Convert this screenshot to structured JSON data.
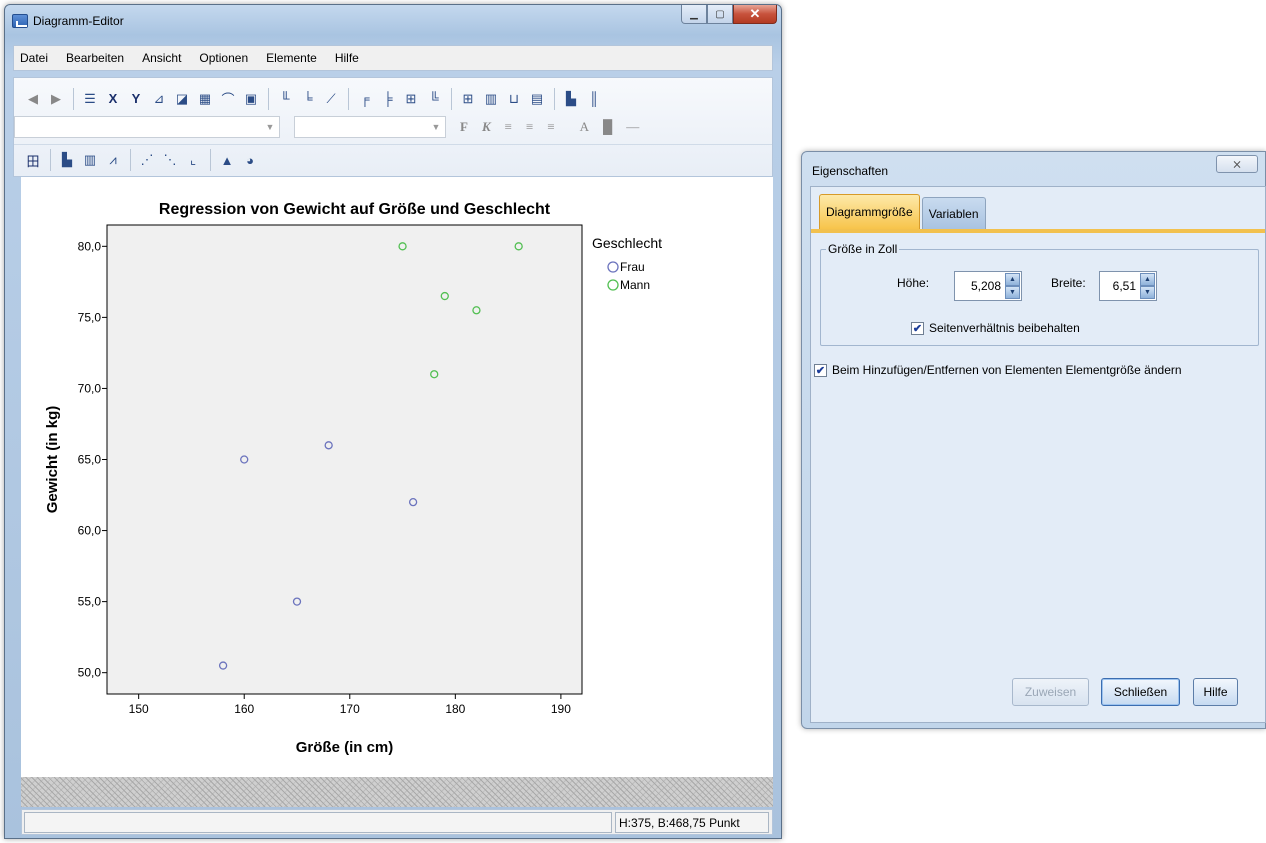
{
  "editor": {
    "title": "Diagramm-Editor",
    "menu": [
      "Datei",
      "Bearbeiten",
      "Ansicht",
      "Optionen",
      "Elemente",
      "Hilfe"
    ],
    "status_text": "H:375, B:468,75 Punkt",
    "toolbar": {
      "bold_label": "F",
      "italic_label": "K",
      "font_color_label": "A"
    }
  },
  "chart_data": {
    "type": "scatter",
    "title": "Regression von Gewicht auf Größe und Geschlecht",
    "xlabel": "Größe (in cm)",
    "ylabel": "Gewicht (in kg)",
    "xlim": [
      147,
      192
    ],
    "ylim": [
      48.5,
      81.5
    ],
    "xticks": [
      150,
      160,
      170,
      180,
      190
    ],
    "yticks": [
      50,
      55,
      60,
      65,
      70,
      75,
      80
    ],
    "ytick_labels": [
      "50,0",
      "55,0",
      "60,0",
      "65,0",
      "70,0",
      "75,0",
      "80,0"
    ],
    "legend_title": "Geschlecht",
    "legend_position": "right",
    "grid": false,
    "background": "#f0f0f0",
    "series": [
      {
        "name": "Frau",
        "color": "#6b73bd",
        "points": [
          [
            158,
            50.5
          ],
          [
            160,
            65
          ],
          [
            165,
            55
          ],
          [
            168,
            66
          ],
          [
            176,
            62
          ]
        ]
      },
      {
        "name": "Mann",
        "color": "#52bf52",
        "points": [
          [
            175,
            80
          ],
          [
            178,
            71
          ],
          [
            179,
            76.5
          ],
          [
            182,
            75.5
          ],
          [
            186,
            80
          ]
        ]
      }
    ]
  },
  "dialog": {
    "title": "Eigenschaften",
    "close_label": "⨯",
    "tabs": [
      "Diagrammgröße",
      "Variablen"
    ],
    "group_label": "Größe in Zoll",
    "height_label": "Höhe:",
    "height_value": "5,208",
    "width_label": "Breite:",
    "width_value": "6,51",
    "aspect_label": "Seitenverhältnis beibehalten",
    "aspect_checked": true,
    "resize_label": "Beim Hinzufügen/Entfernen von Elementen Elementgröße ändern",
    "resize_checked": true,
    "buttons": {
      "apply": "Zuweisen",
      "close": "Schließen",
      "help": "Hilfe"
    }
  }
}
